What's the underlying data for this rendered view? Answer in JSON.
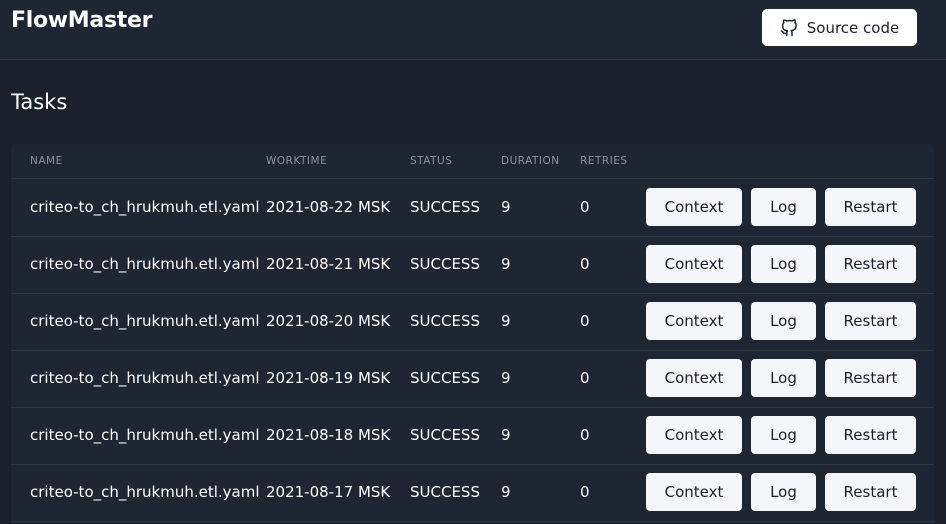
{
  "app": {
    "title": "FlowMaster",
    "source_button_label": "Source code",
    "source_icon": "github-icon"
  },
  "page": {
    "title": "Tasks"
  },
  "table": {
    "columns": [
      "NAME",
      "WORKTIME",
      "STATUS",
      "DURATION",
      "RETRIES"
    ],
    "action_labels": {
      "context": "Context",
      "log": "Log",
      "restart": "Restart"
    },
    "rows": [
      {
        "name": "criteo-to_ch_hrukmuh.etl.yaml",
        "worktime": "2021-08-22 MSK",
        "status": "SUCCESS",
        "duration": "9",
        "retries": "0"
      },
      {
        "name": "criteo-to_ch_hrukmuh.etl.yaml",
        "worktime": "2021-08-21 MSK",
        "status": "SUCCESS",
        "duration": "9",
        "retries": "0"
      },
      {
        "name": "criteo-to_ch_hrukmuh.etl.yaml",
        "worktime": "2021-08-20 MSK",
        "status": "SUCCESS",
        "duration": "9",
        "retries": "0"
      },
      {
        "name": "criteo-to_ch_hrukmuh.etl.yaml",
        "worktime": "2021-08-19 MSK",
        "status": "SUCCESS",
        "duration": "9",
        "retries": "0"
      },
      {
        "name": "criteo-to_ch_hrukmuh.etl.yaml",
        "worktime": "2021-08-18 MSK",
        "status": "SUCCESS",
        "duration": "9",
        "retries": "0"
      },
      {
        "name": "criteo-to_ch_hrukmuh.etl.yaml",
        "worktime": "2021-08-17 MSK",
        "status": "SUCCESS",
        "duration": "9",
        "retries": "0"
      }
    ]
  }
}
